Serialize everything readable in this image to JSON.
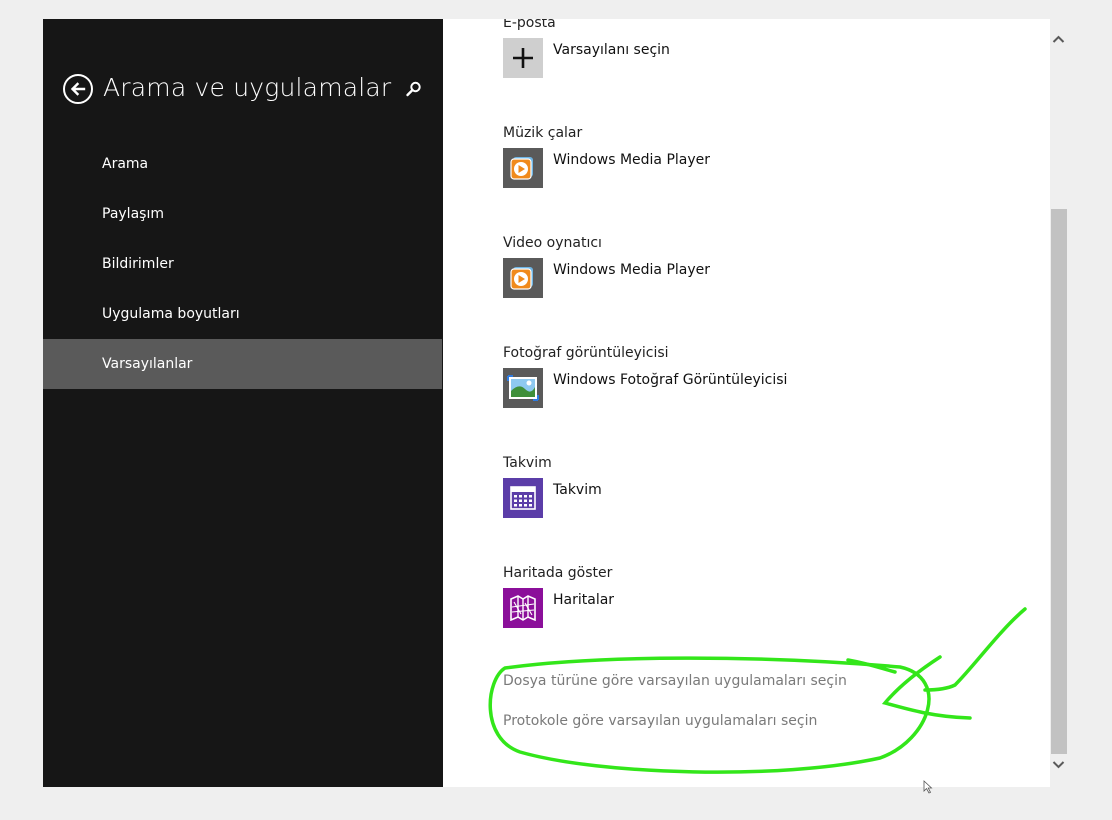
{
  "sidebar": {
    "title": "Arama ve uygulamalar",
    "items": [
      {
        "label": "Arama"
      },
      {
        "label": "Paylaşım"
      },
      {
        "label": "Bildirimler"
      },
      {
        "label": "Uygulama boyutları"
      },
      {
        "label": "Varsayılanlar"
      }
    ],
    "selected_index": 4
  },
  "defaults": [
    {
      "label": "E-posta",
      "app": "Varsayılanı seçin",
      "icon": "plus-icon",
      "tile_color": "#cfcfcf"
    },
    {
      "label": "Müzik çalar",
      "app": "Windows Media Player",
      "icon": "windows-media-player-icon",
      "tile_color": "#5a5a5a"
    },
    {
      "label": "Video oynatıcı",
      "app": "Windows Media Player",
      "icon": "windows-media-player-icon",
      "tile_color": "#5a5a5a"
    },
    {
      "label": "Fotoğraf görüntüleyicisi",
      "app": "Windows Fotoğraf Görüntüleyicisi",
      "icon": "photo-viewer-icon",
      "tile_color": "#5a5a5a"
    },
    {
      "label": "Takvim",
      "app": "Takvim",
      "icon": "calendar-icon",
      "tile_color": "#5b3da8"
    },
    {
      "label": "Haritada göster",
      "app": "Haritalar",
      "icon": "maps-icon",
      "tile_color": "#8b0f9a"
    }
  ],
  "links": {
    "by_file_type": "Dosya türüne göre varsayılan uygulamaları seçin",
    "by_protocol": "Protokole göre varsayılan uygulamaları seçin"
  },
  "colors": {
    "sidebar_bg": "#161616",
    "selected_item_bg": "#5a5a5a",
    "link_text": "#7a7a7a",
    "annotation": "#33e61a"
  }
}
